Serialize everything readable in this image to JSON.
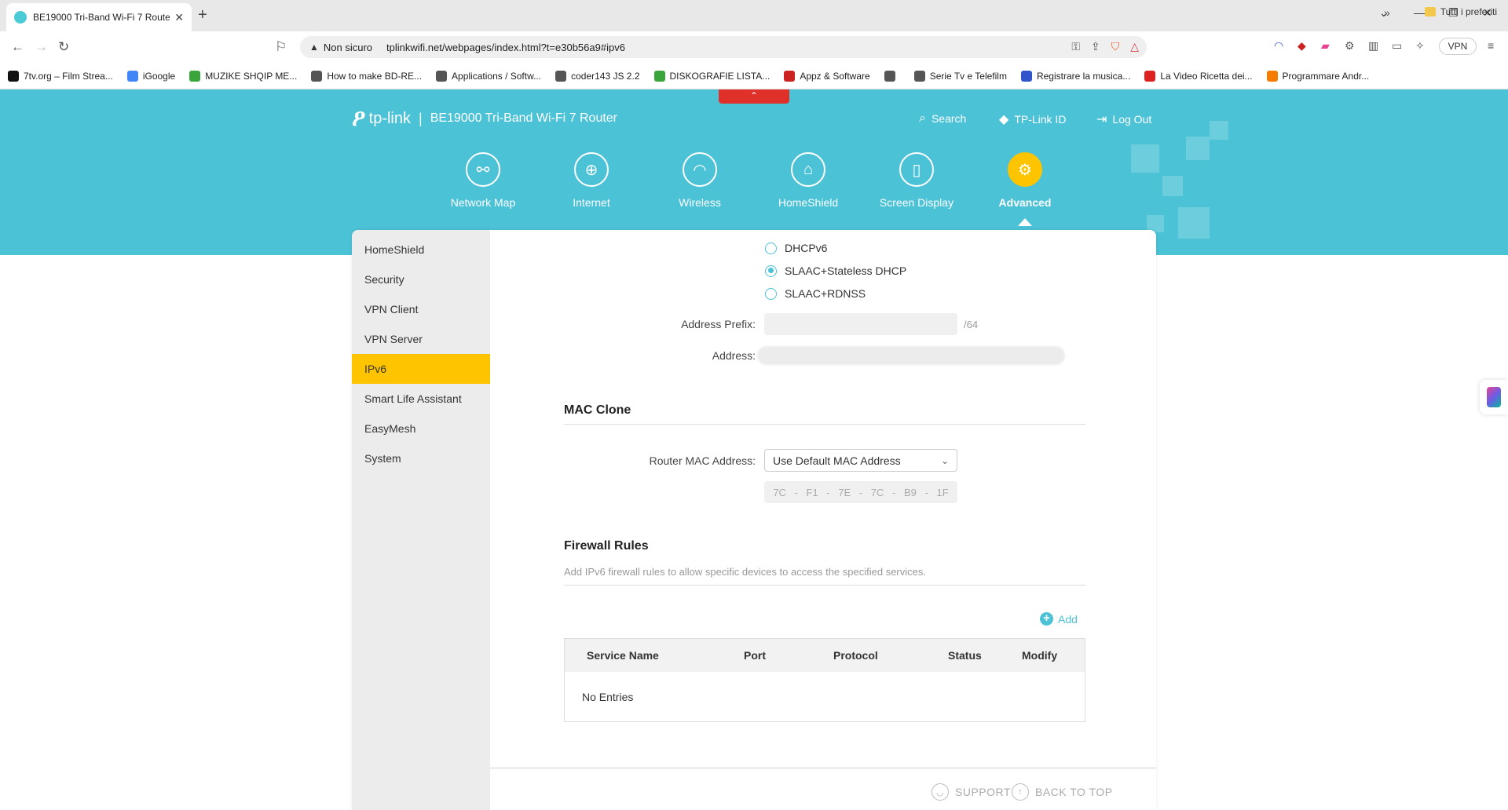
{
  "browser": {
    "tab_title": "BE19000 Tri-Band Wi-Fi 7 Route",
    "insecure_label": "Non sicuro",
    "url": "tplinkwifi.net/webpages/index.html?t=e30b56a9#ipv6",
    "vpn_label": "VPN",
    "bookmarks": [
      {
        "label": "7tv.org – Film Strea...",
        "color": "#111111"
      },
      {
        "label": "iGoogle",
        "color": "#4285f4"
      },
      {
        "label": "MUZIKE SHQIP ME...",
        "color": "#3aa53a"
      },
      {
        "label": "How to make BD-RE...",
        "color": "#555555"
      },
      {
        "label": "Applications / Softw...",
        "color": "#555555"
      },
      {
        "label": "coder143 JS 2.2",
        "color": "#555555"
      },
      {
        "label": "DISKOGRAFIE LISTA...",
        "color": "#3aa53a"
      },
      {
        "label": "Appz & Software",
        "color": "#cc2222"
      },
      {
        "label": "",
        "color": "#555555"
      },
      {
        "label": "Serie Tv e Telefilm",
        "color": "#555555"
      },
      {
        "label": "Registrare la musica...",
        "color": "#3355cc"
      },
      {
        "label": "La Video Ricetta dei...",
        "color": "#dd2222"
      },
      {
        "label": "Programmare Andr...",
        "color": "#f57c00"
      }
    ],
    "all_bookmarks": "Tutti i preferiti"
  },
  "router": {
    "brand": "tp-link",
    "model": "BE19000 Tri-Band Wi-Fi 7 Router",
    "top_links": {
      "search": "Search",
      "tplink_id": "TP-Link ID",
      "logout": "Log Out"
    },
    "main_nav": [
      {
        "label": "Network Map",
        "icon": "network-map-icon"
      },
      {
        "label": "Internet",
        "icon": "globe-icon"
      },
      {
        "label": "Wireless",
        "icon": "wifi-icon"
      },
      {
        "label": "HomeShield",
        "icon": "homeshield-icon"
      },
      {
        "label": "Screen Display",
        "icon": "screen-display-icon"
      },
      {
        "label": "Advanced",
        "icon": "advanced-gear-icon",
        "active": true
      }
    ],
    "sidebar": [
      {
        "label": "HomeShield"
      },
      {
        "label": "Security"
      },
      {
        "label": "VPN Client"
      },
      {
        "label": "VPN Server"
      },
      {
        "label": "IPv6",
        "active": true
      },
      {
        "label": "Smart Life Assistant"
      },
      {
        "label": "EasyMesh"
      },
      {
        "label": "System"
      }
    ],
    "ipv6": {
      "options": [
        {
          "label": "DHCPv6",
          "selected": false
        },
        {
          "label": "SLAAC+Stateless DHCP",
          "selected": true
        },
        {
          "label": "SLAAC+RDNSS",
          "selected": false
        }
      ],
      "address_prefix_label": "Address Prefix:",
      "address_prefix_value": "",
      "prefix_suffix": "/64",
      "address_label": "Address:"
    },
    "mac_clone": {
      "title": "MAC Clone",
      "router_mac_label": "Router MAC Address:",
      "selected_option": "Use Default MAC Address",
      "mac_octets": [
        "7C",
        "F1",
        "7E",
        "7C",
        "B9",
        "1F"
      ]
    },
    "firewall": {
      "title": "Firewall Rules",
      "description": "Add IPv6 firewall rules to allow specific devices to access the specified services.",
      "add_label": "Add",
      "columns": {
        "service": "Service Name",
        "port": "Port",
        "protocol": "Protocol",
        "status": "Status",
        "modify": "Modify"
      },
      "empty_text": "No Entries"
    },
    "footer": {
      "support": "SUPPORT",
      "back_to_top": "BACK TO TOP"
    },
    "colors": {
      "accent": "#4cc2d6",
      "active": "#ffc400"
    }
  }
}
